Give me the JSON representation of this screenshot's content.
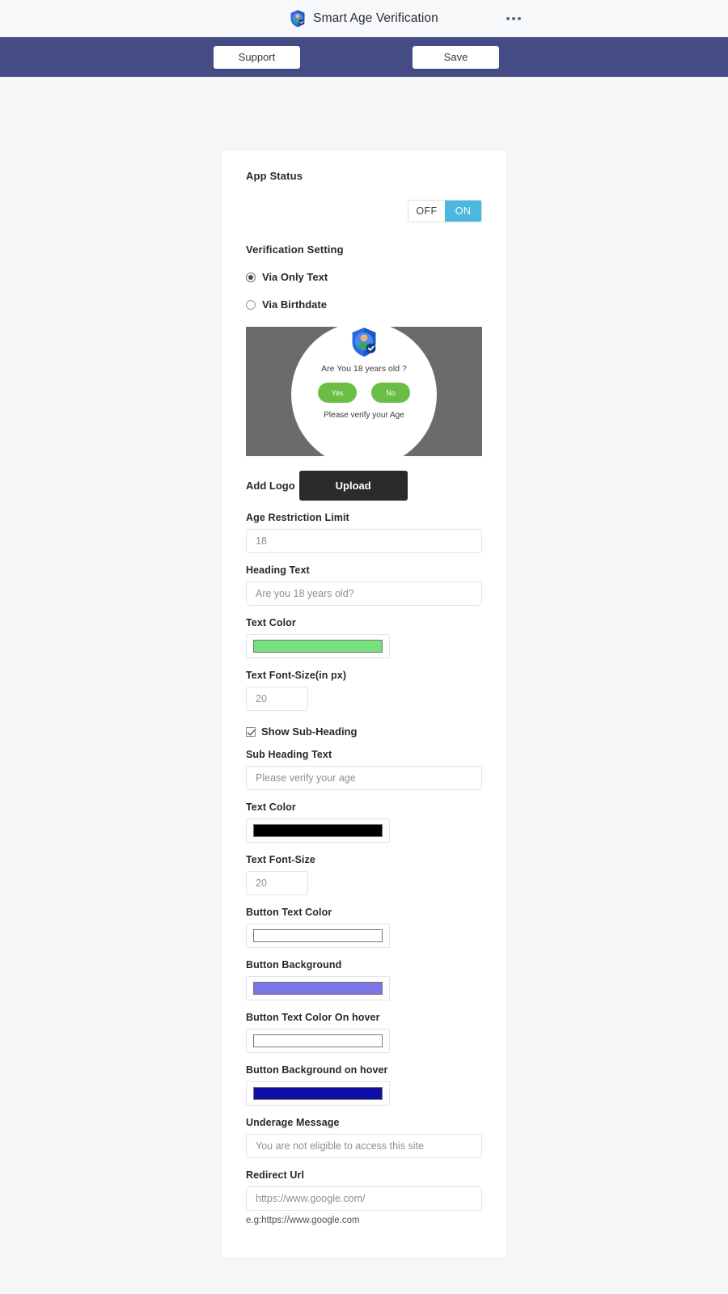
{
  "appbar": {
    "title": "Smart Age Verification",
    "logo_icon": "shield-person-icon",
    "menu_icon": "kebab-menu-icon"
  },
  "actionbar": {
    "support_label": "Support",
    "save_label": "Save",
    "background_color": "#454c85"
  },
  "form": {
    "app_status": {
      "title": "App Status",
      "toggle": {
        "off_label": "OFF",
        "on_label": "ON",
        "selected": "ON",
        "on_color": "#4bb8dd"
      }
    },
    "verification_setting": {
      "title": "Verification Setting",
      "options": [
        {
          "label": "Via Only Text",
          "selected": true
        },
        {
          "label": "Via Birthdate",
          "selected": false
        }
      ]
    },
    "preview": {
      "background_color": "#6b6b6b",
      "logo_icon": "shield-person-icon",
      "heading": "Are You 18 years old ?",
      "yes_label": "Yes",
      "no_label": "No",
      "button_color": "#6cbd45",
      "subheading": "Please verify your Age"
    },
    "add_logo": {
      "label": "Add Logo",
      "upload_label": "Upload"
    },
    "age_restriction_limit": {
      "label": "Age Restriction Limit",
      "value": "18"
    },
    "heading_text": {
      "label": "Heading Text",
      "value": "Are you 18 years old?"
    },
    "heading_text_color": {
      "label": "Text Color",
      "value": "#77e07a"
    },
    "heading_font_size": {
      "label": "Text Font-Size(in px)",
      "value": "20"
    },
    "show_subheading": {
      "label": "Show Sub-Heading",
      "checked": true
    },
    "sub_heading_text": {
      "label": "Sub Heading Text",
      "value": "Please verify your age"
    },
    "sub_heading_text_color": {
      "label": "Text Color",
      "value": "#000000"
    },
    "sub_heading_font_size": {
      "label": "Text Font-Size",
      "value": "20"
    },
    "button_text_color": {
      "label": "Button Text Color",
      "value": "#ffffff"
    },
    "button_background": {
      "label": "Button Background",
      "value": "#7b76e8"
    },
    "button_text_color_hover": {
      "label": "Button Text Color On hover",
      "value": "#ffffff"
    },
    "button_background_hover": {
      "label": "Button Background on hover",
      "value": "#0f0fa8"
    },
    "underage_message": {
      "label": "Underage Message",
      "value": "You are not eligible to access this site"
    },
    "redirect_url": {
      "label": "Redirect Url",
      "value": "https://www.google.com/",
      "helper": "e.g:https://www.google.com"
    }
  }
}
